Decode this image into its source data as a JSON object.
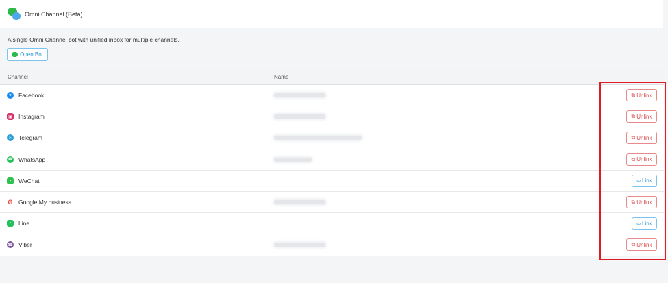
{
  "header": {
    "title": "Omni Channel (Beta)",
    "icon": "chat-bubbles-icon"
  },
  "description": "A single Omni Channel bot with unified inbox for multiple channels.",
  "open_bot": {
    "label": "Open Bot",
    "icon": "chat-bubbles-icon"
  },
  "table": {
    "columns": {
      "channel": "Channel",
      "name": "Name"
    },
    "rows": [
      {
        "channel": "Facebook",
        "icon": "messenger-icon",
        "color": "#1a8cf0",
        "linked": true,
        "action": "Unlink"
      },
      {
        "channel": "Instagram",
        "icon": "instagram-icon",
        "color": "#d6336c",
        "linked": true,
        "action": "Unlink"
      },
      {
        "channel": "Telegram",
        "icon": "telegram-icon",
        "color": "#2a9fd8",
        "linked": true,
        "action": "Unlink"
      },
      {
        "channel": "WhatsApp",
        "icon": "whatsapp-icon",
        "color": "#25c05a",
        "linked": true,
        "action": "Unlink"
      },
      {
        "channel": "WeChat",
        "icon": "wechat-icon",
        "color": "#2dc14e",
        "linked": false,
        "action": "Link"
      },
      {
        "channel": "Google My business",
        "icon": "google-icon",
        "color": "#ea4335",
        "linked": true,
        "action": "Unlink"
      },
      {
        "channel": "Line",
        "icon": "line-icon",
        "color": "#22c05a",
        "linked": false,
        "action": "Link"
      },
      {
        "channel": "Viber",
        "icon": "viber-icon",
        "color": "#7b519d",
        "linked": true,
        "action": "Unlink"
      }
    ]
  },
  "colors": {
    "unlink": "#d94b4b",
    "link": "#2f98d8",
    "highlight": "#e01b22"
  }
}
